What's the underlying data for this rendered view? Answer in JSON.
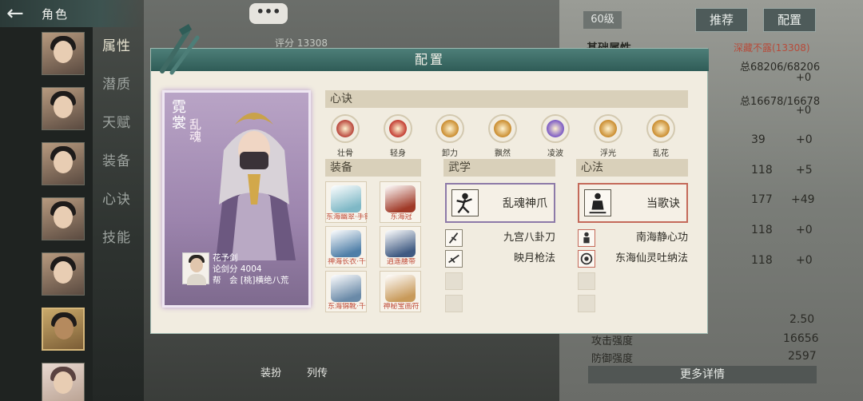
{
  "topbar": {
    "back_icon": "back-arrow-icon",
    "title": "角色"
  },
  "sidebar": {
    "menu": [
      "属性",
      "潜质",
      "天赋",
      "装备",
      "心诀",
      "技能"
    ],
    "active_menu_index": 0
  },
  "chat_button": "•••",
  "background": {
    "score": "评分 13308",
    "level": "60级",
    "recommend_button": "推荐",
    "config_button": "配置",
    "attr_title": "基础属性",
    "attr_hidden": "深藏不露(13308)",
    "hp_line": "总68206/68206",
    "plus_zero": "+0",
    "mp_line": "总16678/16678",
    "stat_rows": [
      {
        "value": "39",
        "bonus": "+0"
      },
      {
        "value": "118",
        "bonus": "+5"
      },
      {
        "value": "177",
        "bonus": "+49"
      },
      {
        "value": "118",
        "bonus": "+0"
      },
      {
        "value": "118",
        "bonus": "+0"
      }
    ],
    "stat_value_1": "2.50",
    "attack_label": "攻击强度",
    "attack_value": "16656",
    "defense_label": "防御强度",
    "defense_value": "2597",
    "more_details": "更多详情",
    "dress_button": "装扮",
    "biography_button": "列传"
  },
  "modal": {
    "title": "配置",
    "character": {
      "title": "霓裳",
      "subtitle": "乱魂",
      "owner_name": "花予剑",
      "owner_score": "论剑分 4004",
      "owner_guild": "帮　会 [桃]横绝八荒"
    },
    "xinjue_header": "心诀",
    "xinjue_skills": [
      {
        "name": "壮骨",
        "color": "#b8443a"
      },
      {
        "name": "轻身",
        "color": "#c23a30"
      },
      {
        "name": "卸力",
        "color": "#c98b2c"
      },
      {
        "name": "飘然",
        "color": "#c98b2c"
      },
      {
        "name": "凌波",
        "color": "#7a58c4"
      },
      {
        "name": "浮光",
        "color": "#c98b2c"
      },
      {
        "name": "乱花",
        "color": "#c98b2c"
      }
    ],
    "equip_header": "装备",
    "equipment": [
      {
        "name": "东海幽翠·手镯",
        "color": "#7fb8c6"
      },
      {
        "name": "东海冠",
        "color": "#a03a28"
      },
      {
        "name": "神海长衣·千",
        "color": "#4f7fa8"
      },
      {
        "name": "逍遥腰带",
        "color": "#3f5a82"
      },
      {
        "name": "东海锦靴·千",
        "color": "#6a8aa8"
      },
      {
        "name": "神秘宝画符",
        "color": "#c89a5a"
      }
    ],
    "wuxue_header": "武学",
    "wuxue_main": "乱魂神爪",
    "wuxue_subs": [
      "九宫八卦刀",
      "映月枪法"
    ],
    "xinfa_header": "心法",
    "xinfa_main": "当歌诀",
    "xinfa_subs": [
      "南海静心功",
      "东海仙灵吐纳法"
    ]
  }
}
